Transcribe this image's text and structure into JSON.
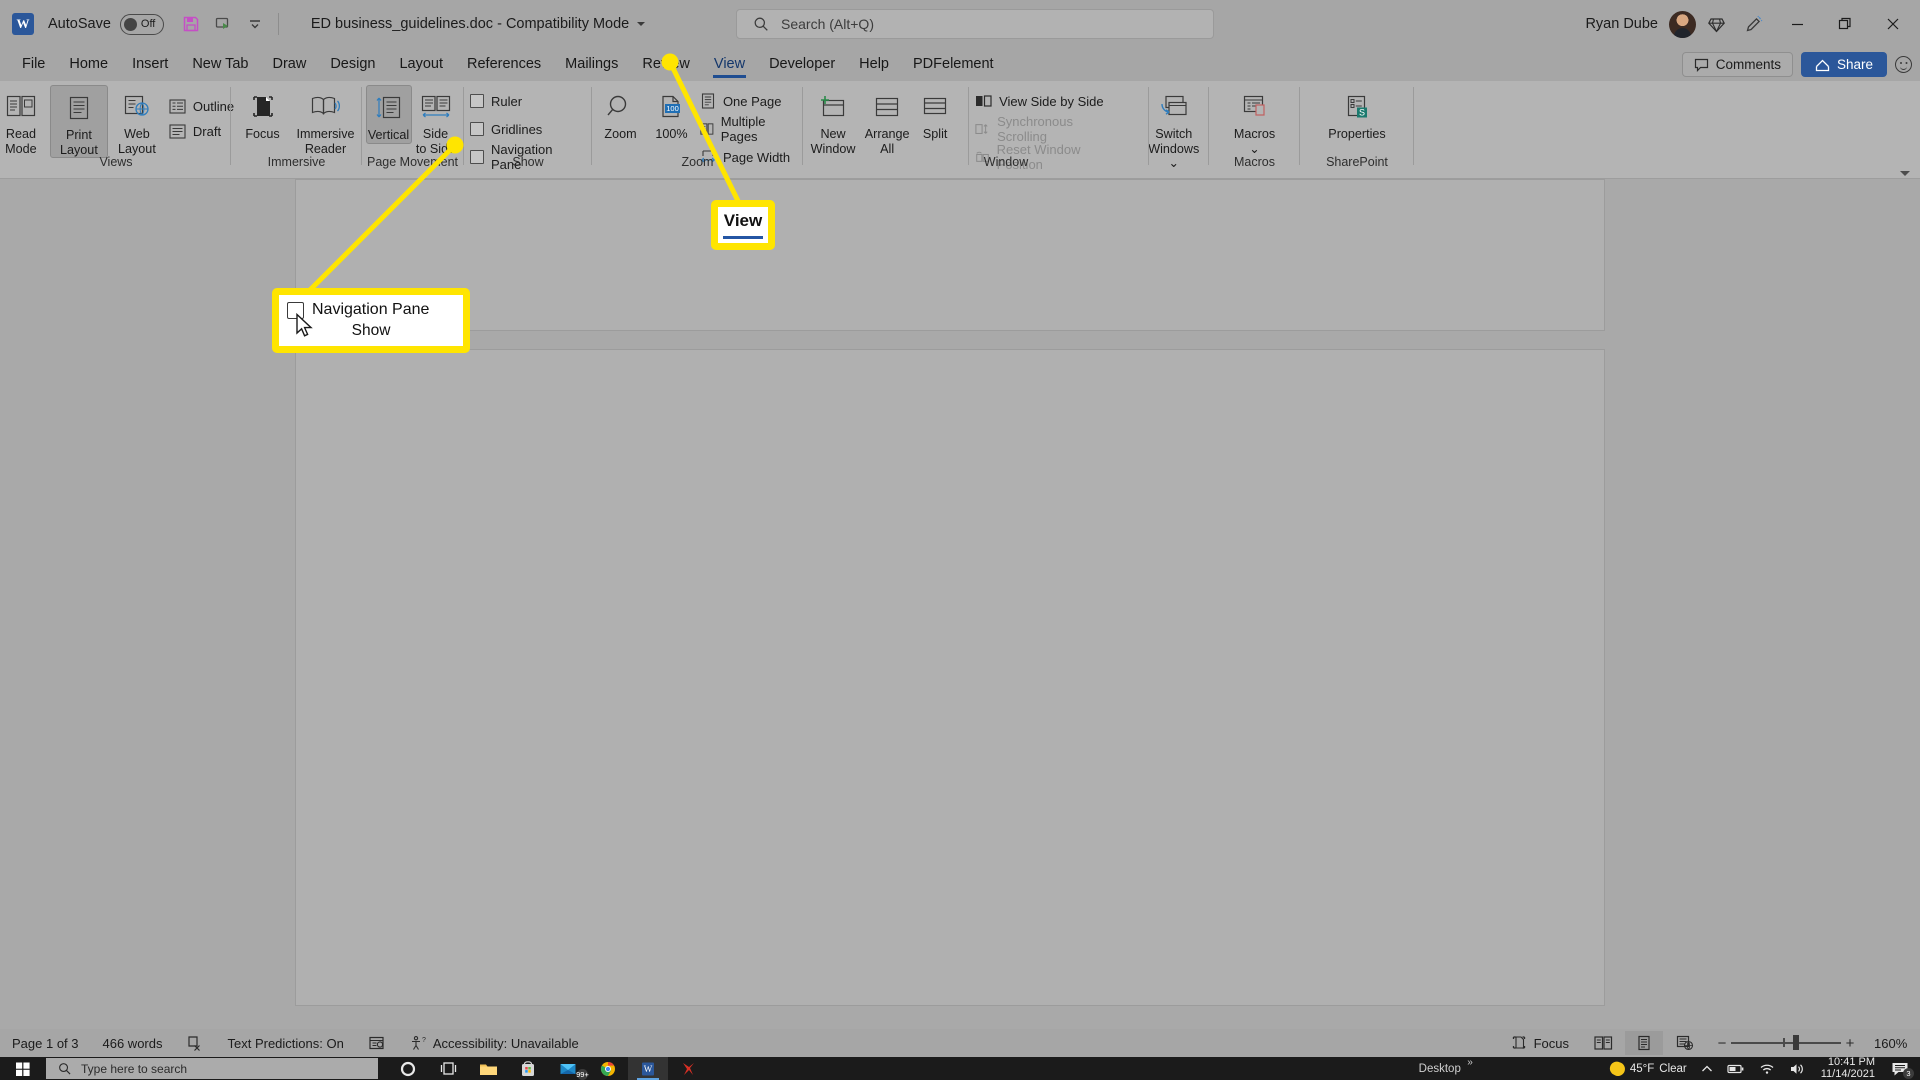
{
  "titlebar": {
    "app_logo": "word-logo",
    "autosave_label": "AutoSave",
    "autosave_state": "Off",
    "document_title": "ED business_guidelines.doc  -  Compatibility Mode",
    "user_name": "Ryan Dube",
    "qat_icons": [
      "save-icon",
      "track-changes-icon",
      "customize-qat-icon"
    ],
    "right_icons": [
      "diamond-icon",
      "pen-icon"
    ],
    "window_buttons": [
      "minimize-button",
      "restore-button",
      "close-button"
    ]
  },
  "search": {
    "placeholder": "Search (Alt+Q)",
    "icon": "search-icon"
  },
  "tabs": [
    {
      "label": "File",
      "active": false
    },
    {
      "label": "Home",
      "active": false
    },
    {
      "label": "Insert",
      "active": false
    },
    {
      "label": "New Tab",
      "active": false
    },
    {
      "label": "Draw",
      "active": false
    },
    {
      "label": "Design",
      "active": false
    },
    {
      "label": "Layout",
      "active": false
    },
    {
      "label": "References",
      "active": false
    },
    {
      "label": "Mailings",
      "active": false
    },
    {
      "label": "Review",
      "active": false
    },
    {
      "label": "View",
      "active": true
    },
    {
      "label": "Developer",
      "active": false
    },
    {
      "label": "Help",
      "active": false
    },
    {
      "label": "PDFelement",
      "active": false
    }
  ],
  "tabbar_right": {
    "comments_label": "Comments",
    "share_label": "Share",
    "smiley_icon": "feedback-smiley-icon"
  },
  "ribbon": {
    "groups": [
      {
        "name": "Views",
        "label": "Views",
        "big_buttons": [
          {
            "label_line1": "Read",
            "label_line2": "Mode",
            "icon": "read-mode-icon",
            "selected": false
          },
          {
            "label_line1": "Print",
            "label_line2": "Layout",
            "icon": "print-layout-icon",
            "selected": true
          },
          {
            "label_line1": "Web",
            "label_line2": "Layout",
            "icon": "web-layout-icon",
            "selected": false
          }
        ],
        "small_items": [
          {
            "label": "Outline",
            "icon": "outline-icon"
          },
          {
            "label": "Draft",
            "icon": "draft-icon"
          }
        ]
      },
      {
        "name": "Immersive",
        "label": "Immersive",
        "big_buttons": [
          {
            "label_line1": "Focus",
            "label_line2": "",
            "icon": "focus-icon",
            "selected": false
          },
          {
            "label_line1": "Immersive",
            "label_line2": "Reader",
            "icon": "immersive-reader-icon",
            "selected": false
          }
        ],
        "small_items": []
      },
      {
        "name": "Page Movement",
        "label": "Page Movement",
        "big_buttons": [
          {
            "label_line1": "Vertical",
            "label_line2": "",
            "icon": "vertical-scroll-icon",
            "selected": true
          },
          {
            "label_line1": "Side",
            "label_line2": "to Side",
            "icon": "side-to-side-icon",
            "selected": false
          }
        ],
        "small_items": []
      },
      {
        "name": "Show",
        "label": "Show",
        "big_buttons": [],
        "small_items": [
          {
            "label": "Ruler",
            "checked": false
          },
          {
            "label": "Gridlines",
            "checked": false
          },
          {
            "label": "Navigation Pane",
            "checked": false
          }
        ]
      },
      {
        "name": "Zoom",
        "label": "Zoom",
        "big_buttons": [
          {
            "label_line1": "Zoom",
            "label_line2": "",
            "icon": "zoom-magnifier-icon",
            "selected": false
          },
          {
            "label_line1": "100%",
            "label_line2": "",
            "icon": "zoom-100-icon",
            "selected": false
          }
        ],
        "small_items": [
          {
            "label": "One Page",
            "icon": "one-page-icon"
          },
          {
            "label": "Multiple Pages",
            "icon": "multiple-pages-icon"
          },
          {
            "label": "Page Width",
            "icon": "page-width-icon"
          }
        ]
      },
      {
        "name": "Window",
        "label": "Window",
        "big_buttons": [
          {
            "label_line1": "New",
            "label_line2": "Window",
            "icon": "new-window-icon",
            "selected": false
          },
          {
            "label_line1": "Arrange",
            "label_line2": "All",
            "icon": "arrange-all-icon",
            "selected": false
          },
          {
            "label_line1": "Split",
            "label_line2": "",
            "icon": "split-icon",
            "selected": false
          },
          {
            "label_line1": "Switch",
            "label_line2": "Windows",
            "icon": "switch-windows-icon",
            "selected": false
          }
        ],
        "small_items": [
          {
            "label": "View Side by Side",
            "icon": "view-side-by-side-icon",
            "disabled": false
          },
          {
            "label": "Synchronous Scrolling",
            "icon": "synchronous-scrolling-icon",
            "disabled": true
          },
          {
            "label": "Reset Window Position",
            "icon": "reset-window-position-icon",
            "disabled": true
          }
        ]
      },
      {
        "name": "Macros",
        "label": "Macros",
        "big_buttons": [
          {
            "label_line1": "Macros",
            "label_line2": "",
            "icon": "macros-icon",
            "selected": false
          }
        ],
        "small_items": []
      },
      {
        "name": "SharePoint",
        "label": "SharePoint",
        "big_buttons": [
          {
            "label_line1": "Properties",
            "label_line2": "",
            "icon": "sharepoint-properties-icon",
            "selected": false
          }
        ],
        "small_items": []
      }
    ],
    "collapse_icon": "ribbon-collapse-icon"
  },
  "callouts": [
    {
      "id": "navigation-pane",
      "checkbox_label": "Navigation Pane",
      "group_label": "Show",
      "border_color": "#ffe500",
      "cursor": "mouse-pointer"
    },
    {
      "id": "view-tab",
      "label": "View",
      "underline_color": "#2456a4",
      "border_color": "#ffe500"
    }
  ],
  "statusbar": {
    "page_info": "Page 1 of 3",
    "word_count": "466 words",
    "proofing_icon": "proofing-errors-icon",
    "text_predictions": "Text Predictions: On",
    "dictate_icon": "display-settings-icon",
    "accessibility": "Accessibility: Unavailable",
    "focus_label": "Focus",
    "view_buttons": [
      {
        "name": "read-mode-view",
        "icon": "read-mode-view-icon",
        "active": false
      },
      {
        "name": "print-layout-view",
        "icon": "print-layout-view-icon",
        "active": true
      },
      {
        "name": "web-layout-view",
        "icon": "web-layout-view-icon",
        "active": false
      }
    ],
    "zoom_out": "−",
    "zoom_in": "+",
    "zoom_value": "160%"
  },
  "taskbar": {
    "start_icon": "windows-start-icon",
    "search_placeholder": "Type here to search",
    "search_icon": "taskbar-search-icon",
    "apps": [
      {
        "name": "cortana-icon",
        "badge": ""
      },
      {
        "name": "task-view-icon",
        "badge": ""
      },
      {
        "name": "file-explorer-icon",
        "badge": ""
      },
      {
        "name": "microsoft-store-icon",
        "badge": ""
      },
      {
        "name": "mail-icon",
        "badge": "99+"
      },
      {
        "name": "google-chrome-icon",
        "badge": ""
      },
      {
        "name": "microsoft-word-icon",
        "badge": ""
      },
      {
        "name": "wps-icon",
        "badge": ""
      }
    ],
    "desktop_label": "Desktop",
    "overflow_icon": "show-hidden-icons-icon",
    "weather_temp": "45°F",
    "weather_desc": "Clear",
    "weather_icon": "moon-icon",
    "tray_icons": [
      "battery-icon",
      "wifi-icon",
      "volume-icon"
    ],
    "time": "10:41 PM",
    "date": "11/14/2021",
    "notification_count": "3",
    "notification_icon": "action-center-icon"
  }
}
